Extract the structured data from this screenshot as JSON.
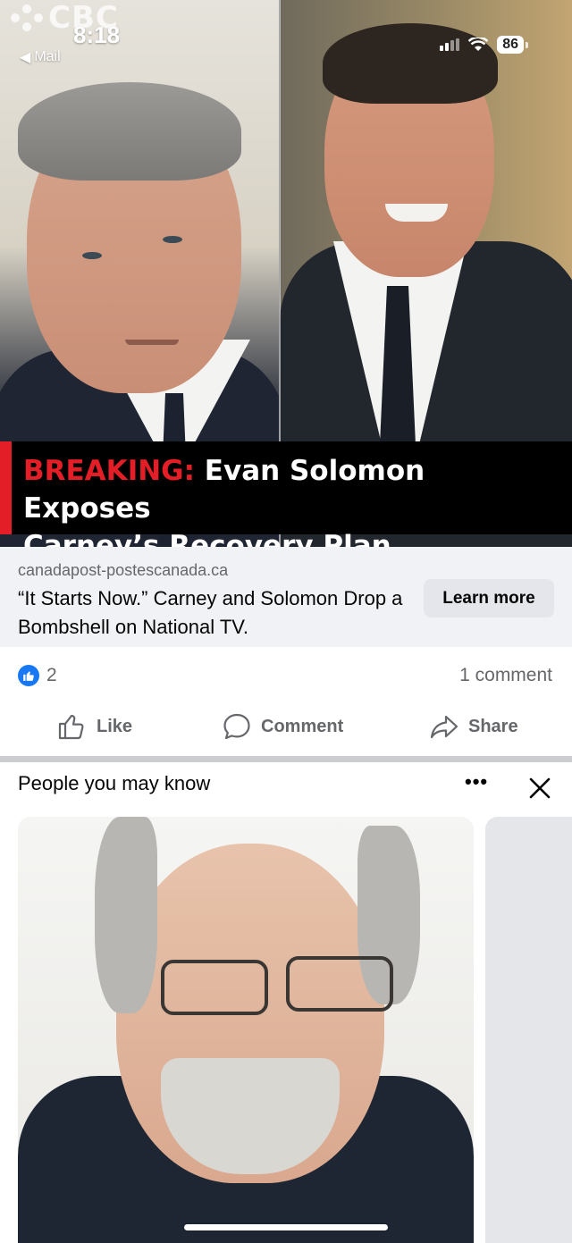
{
  "status_bar": {
    "time": "8:18",
    "back_label": "Mail",
    "battery": "86",
    "overlay_logo": "CBC"
  },
  "ad": {
    "headline_tag": "BREAKING:",
    "headline_line1": " Evan Solomon Exposes",
    "headline_line2": "Carney’s Recovery Plan",
    "domain": "canadapost-postescanada.ca",
    "title": "“It Starts Now.” Carney and Solomon Drop a Bombshell on National TV.",
    "cta_label": "Learn more"
  },
  "reactions": {
    "like_count": "2",
    "comment_count": "1 comment"
  },
  "actions": {
    "like_label": "Like",
    "comment_label": "Comment",
    "share_label": "Share"
  },
  "pymk": {
    "title": "People you may know",
    "more_label": "•••"
  },
  "colors": {
    "brand_blue": "#1877f2",
    "breaking_red": "#e41e26",
    "link_bar_bg": "#f0f2f5",
    "secondary_text": "#65676b"
  },
  "icons": [
    "mail-back-icon",
    "signal-icon",
    "wifi-icon",
    "battery-icon",
    "like-reaction-icon",
    "thumbs-up-icon",
    "comment-bubble-icon",
    "share-arrow-icon",
    "more-options-icon",
    "close-icon"
  ]
}
